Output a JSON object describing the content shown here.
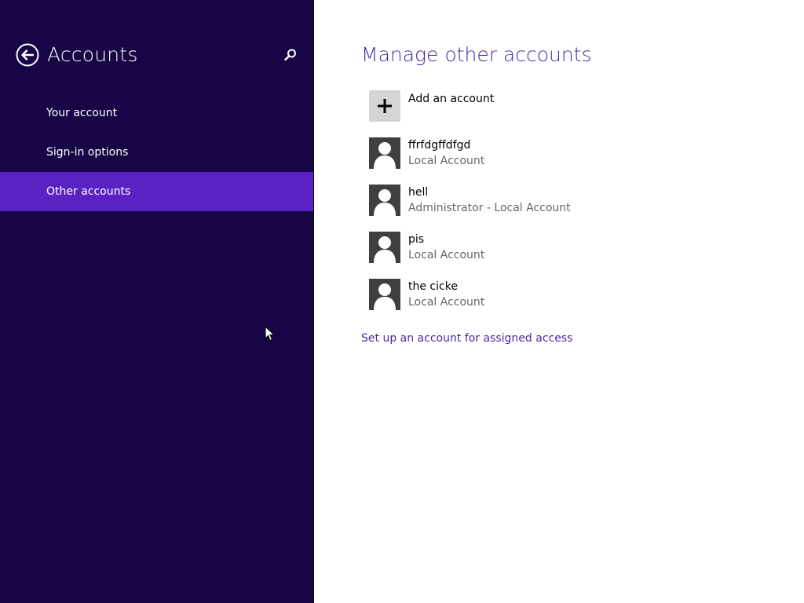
{
  "sidebar": {
    "title": "Accounts",
    "back_icon": "back-arrow-icon",
    "search_icon": "search-icon",
    "items": [
      {
        "label": "Your account",
        "selected": false
      },
      {
        "label": "Sign-in options",
        "selected": false
      },
      {
        "label": "Other accounts",
        "selected": true
      }
    ],
    "colors": {
      "background": "#180545",
      "selected": "#5a22c3"
    }
  },
  "main": {
    "title": "Manage other accounts",
    "add_account": {
      "label": "Add an account",
      "icon": "plus-icon"
    },
    "accounts": [
      {
        "name": "ffrfdgffdfgd",
        "type": "Local Account",
        "icon": "user-avatar-icon"
      },
      {
        "name": "hell",
        "type": "Administrator - Local Account",
        "icon": "user-avatar-icon"
      },
      {
        "name": "pis",
        "type": "Local Account",
        "icon": "user-avatar-icon"
      },
      {
        "name": "the cicke",
        "type": "Local Account",
        "icon": "user-avatar-icon"
      }
    ],
    "assigned_access_link": "Set up an account for assigned access",
    "colors": {
      "accent": "#4b2aa4"
    }
  }
}
